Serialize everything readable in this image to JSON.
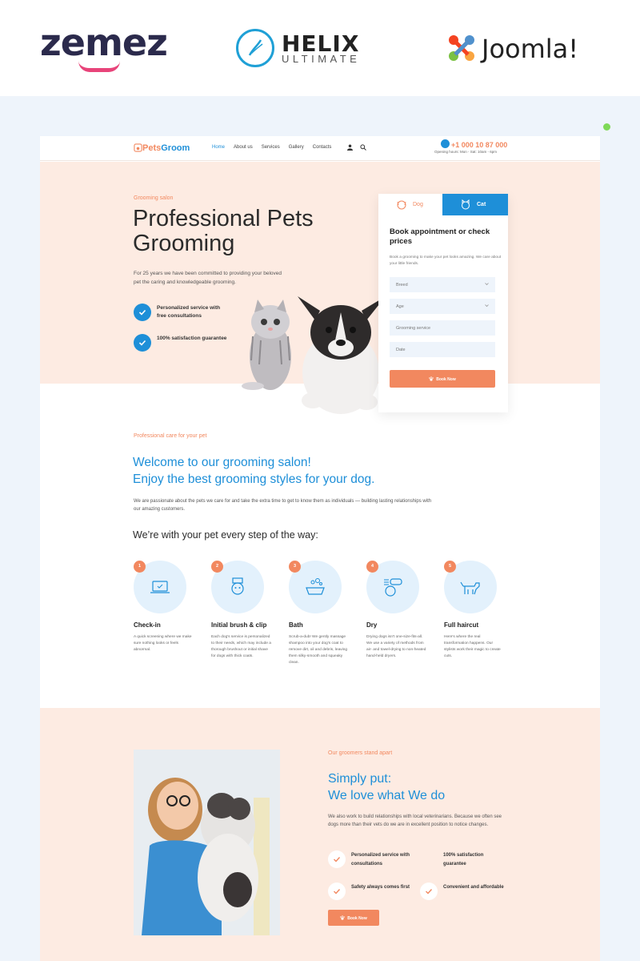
{
  "brands": {
    "zemes": "zemez",
    "helix_title": "HELIX",
    "helix_subtitle": "ULTIMATE",
    "joomla": "Joomla!"
  },
  "colors": {
    "accent_orange": "#f2885f",
    "accent_blue": "#1e8fd8",
    "hero_bg": "#fdebe2",
    "showcase_bg": "#eef4fb"
  },
  "header": {
    "logo_pets": "Pets",
    "logo_groom": "Groom",
    "nav": [
      "Home",
      "About us",
      "Services",
      "Gallery",
      "Contacts"
    ],
    "phone": "+1 000 10 87 000",
    "hours": "Opening hours: Mon - Sat: 10am - 6pm"
  },
  "hero": {
    "eyebrow": "Grooming salon",
    "title": "Professional Pets Grooming",
    "text": "For 25 years we have been committed to providing your beloved pet the caring and knowledgeable grooming.",
    "features": [
      "Personalized service with free consultations",
      "100% satisfaction guarantee"
    ]
  },
  "booking": {
    "tab_dog": "Dog",
    "tab_cat": "Cat",
    "title": "Book appointment or check prices",
    "text": "Book a grooming to make your pet looks amazing. We care about your little friends.",
    "fields": [
      "Breed",
      "Age",
      "Grooming service",
      "Date"
    ],
    "button": "Book Now"
  },
  "about": {
    "eyebrow": "Professional care for your pet",
    "title_line1": "Welcome to our grooming salon!",
    "title_line2": "Enjoy the best grooming styles for your dog.",
    "text": "We are passionate about the pets we care for and take the extra time to get to know them as individuals — building lasting relationships with our amazing customers.",
    "steps_heading": "We’re with your pet every step of the way:"
  },
  "steps": [
    {
      "num": "1",
      "title": "Check-in",
      "text": "A quick screening where we make sure nothing looks or feels abnormal.",
      "icon": "laptop-icon"
    },
    {
      "num": "2",
      "title": "Initial brush & clip",
      "text": "Each dog's service is personalized to their needs, which may include a thorough brushout or initial shave for dogs with thick coats.",
      "icon": "brush-icon"
    },
    {
      "num": "3",
      "title": "Bath",
      "text": "Scrub-a-dub! We gently massage shampoo into your dog's coat to remove dirt, oil and debris, leaving them silky-smooth and squeaky clean.",
      "icon": "bath-icon"
    },
    {
      "num": "4",
      "title": "Dry",
      "text": "Drying dogs isn't one-size-fits-all. We use a variety of methods from air- and towel-drying to non-heated hand-held dryers.",
      "icon": "dryer-icon"
    },
    {
      "num": "5",
      "title": "Full haircut",
      "text": "Here's where the real transformation happens. Our stylists work their magic to create cuts.",
      "icon": "dog-icon"
    }
  ],
  "team": {
    "eyebrow": "Our groomers stand apart",
    "title_line1": "Simply put:",
    "title_line2": "We love what We do",
    "text": "We also work to build relationships with local veterinarians. Because we often see dogs more than their vets do we are in excellent position to notice changes.",
    "features": [
      "Personalized service with consultations",
      "100% satisfaction guarantee",
      "Safety always comes first",
      "Convenient and affordable"
    ],
    "button": "Book Now"
  }
}
